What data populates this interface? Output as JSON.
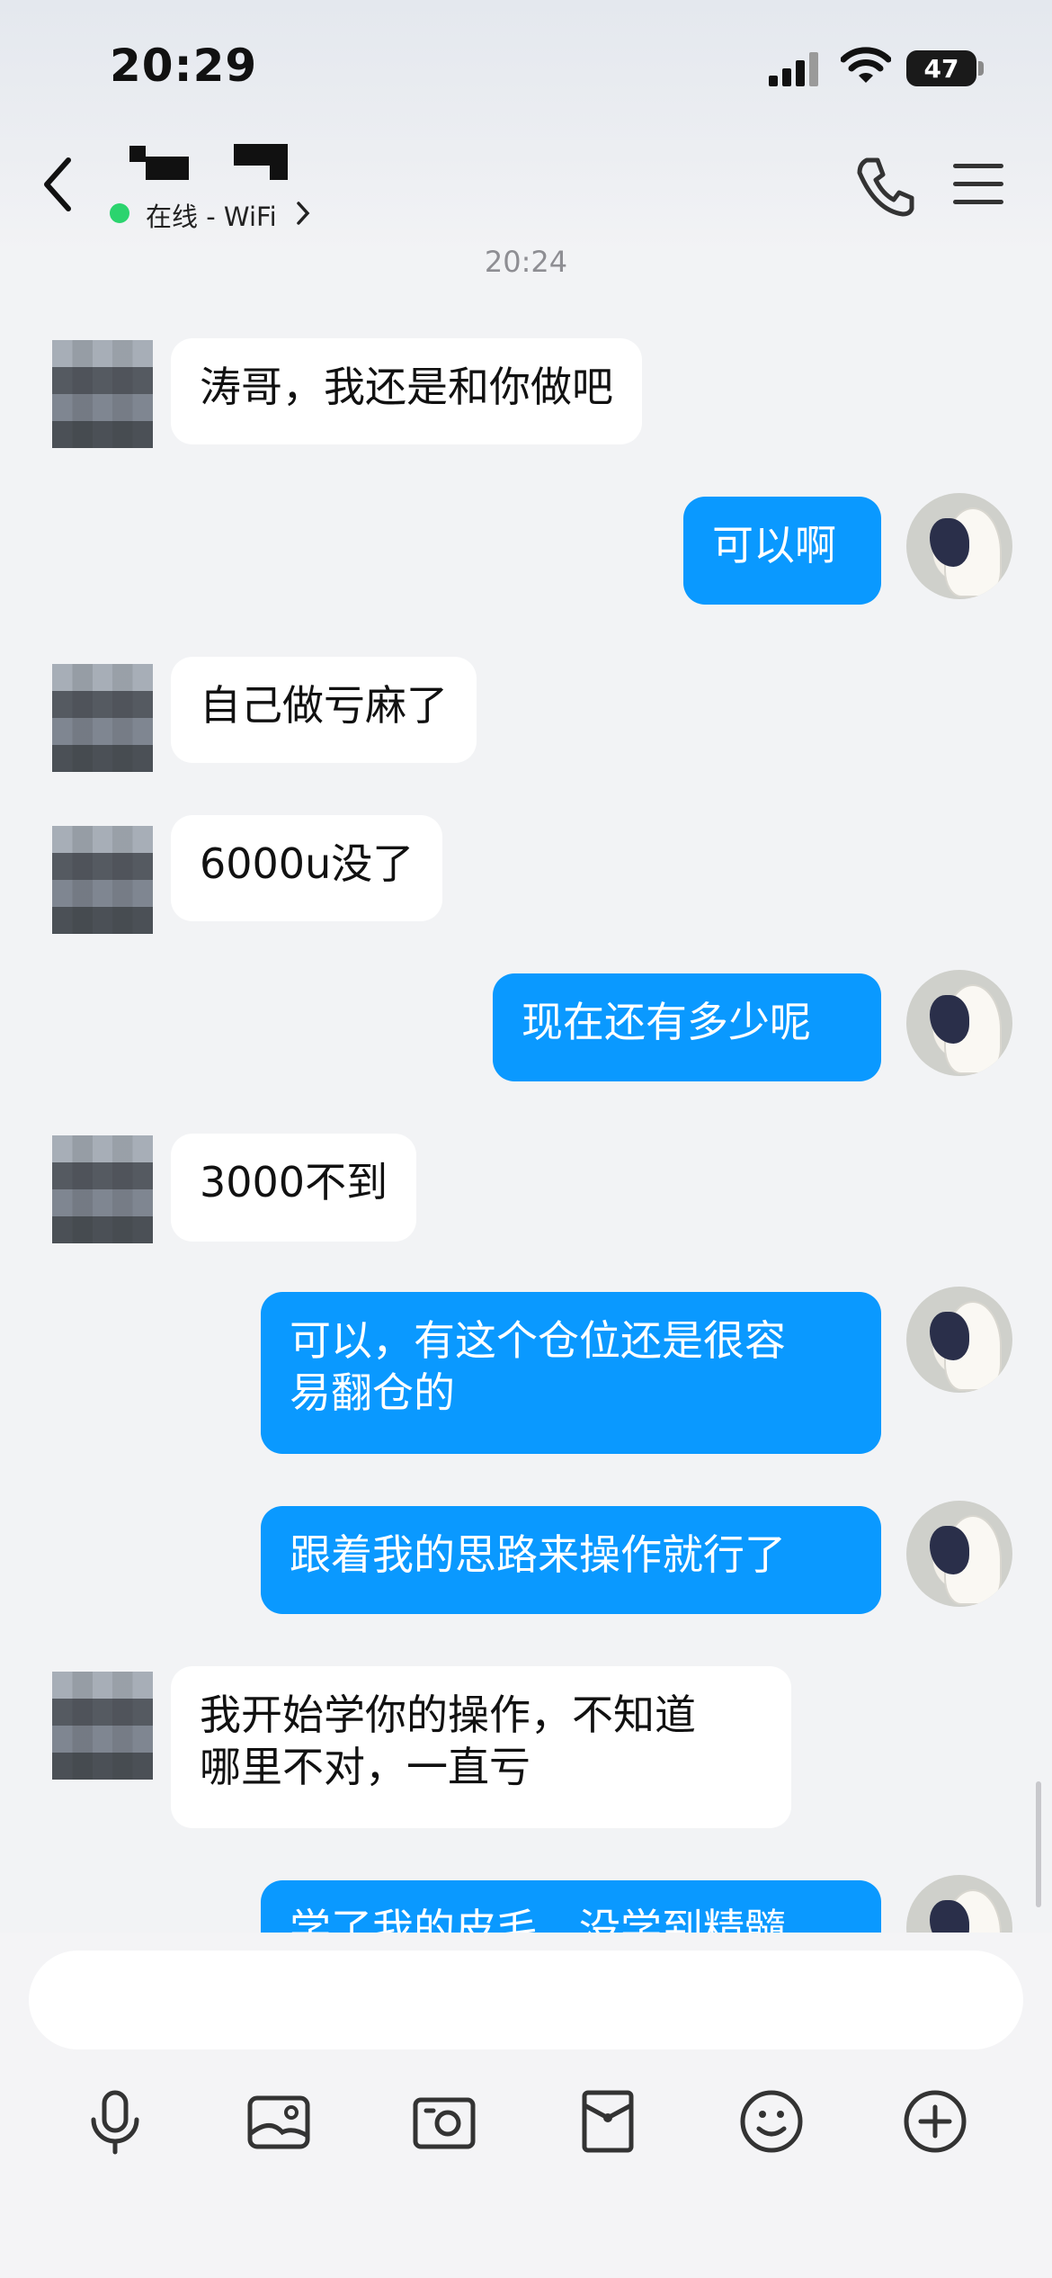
{
  "status_bar": {
    "time": "20:29",
    "battery": "47"
  },
  "header": {
    "status": "在线 - WiFi"
  },
  "chat": {
    "timestamp": "20:24",
    "messages": [
      {
        "side": "in",
        "lines": [
          "涛哥，我还是和你做吧"
        ]
      },
      {
        "side": "out",
        "lines": [
          "可以啊"
        ]
      },
      {
        "side": "in",
        "lines": [
          "自己做亏麻了"
        ]
      },
      {
        "side": "in",
        "lines": [
          "6000u没了"
        ]
      },
      {
        "side": "out",
        "lines": [
          "现在还有多少呢"
        ]
      },
      {
        "side": "in",
        "lines": [
          "3000不到"
        ]
      },
      {
        "side": "out",
        "lines": [
          "可以，有这个仓位还是很容",
          "易翻仓的"
        ]
      },
      {
        "side": "out",
        "lines": [
          "跟着我的思路来操作就行了"
        ]
      },
      {
        "side": "in",
        "lines": [
          "我开始学你的操作，不知道",
          "哪里不对，一直亏"
        ]
      },
      {
        "side": "out",
        "lines": [
          "学了我的皮毛，没学到精髓"
        ]
      }
    ]
  },
  "toolbar": {
    "items": [
      "microphone-icon",
      "image-icon",
      "camera-icon",
      "red-packet-icon",
      "emoji-icon",
      "plus-icon"
    ]
  },
  "colors": {
    "outgoing_bubble": "#0a99ff",
    "incoming_bubble": "#ffffff",
    "online": "#2bd46e"
  }
}
